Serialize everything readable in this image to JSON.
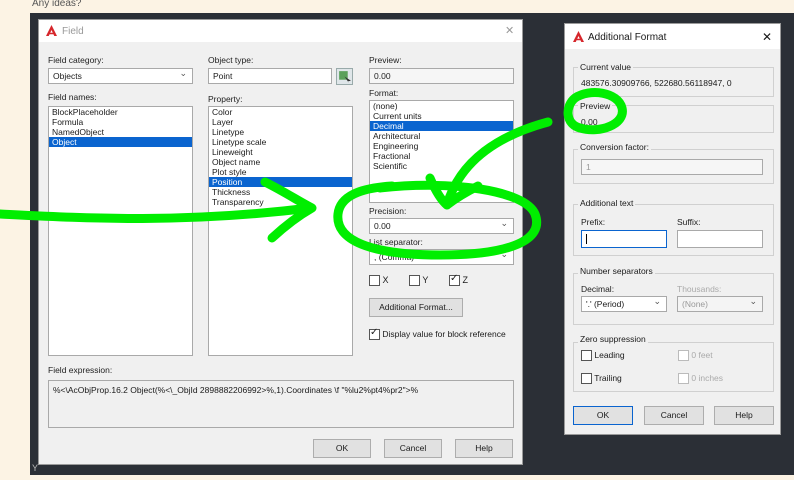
{
  "forum": {
    "question": "Any ideas?"
  },
  "cad": {
    "axis": "Y"
  },
  "field_dialog": {
    "title": "Field",
    "close": "✕",
    "category_label": "Field category:",
    "category_value": "Objects",
    "names_label": "Field names:",
    "names": [
      "BlockPlaceholder",
      "Formula",
      "NamedObject",
      "Object"
    ],
    "names_selected": 3,
    "object_type_label": "Object type:",
    "object_type_value": "Point",
    "property_label": "Property:",
    "properties": [
      "Color",
      "Layer",
      "Linetype",
      "Linetype scale",
      "Lineweight",
      "Object name",
      "Plot style",
      "Position",
      "Thickness",
      "Transparency"
    ],
    "properties_selected": 7,
    "preview_label": "Preview:",
    "preview_value": "0.00",
    "format_label": "Format:",
    "formats": [
      "(none)",
      "Current units",
      "Decimal",
      "Architectural",
      "Engineering",
      "Fractional",
      "Scientific"
    ],
    "formats_selected": 2,
    "precision_label": "Precision:",
    "precision_value": "0.00",
    "list_separator_label": "List separator:",
    "list_separator_value": ", (Comma)",
    "x_label": "X",
    "y_label": "Y",
    "z_label": "Z",
    "z_checked": true,
    "additional_format_btn": "Additional Format...",
    "display_value_label": "Display value for block reference",
    "display_value_checked": true,
    "expression_label": "Field expression:",
    "expression": "%<\\AcObjProp.16.2 Object(%<\\_ObjId 2898882206992>%,1).Coordinates \\f \"%lu2%pt4%pr2\">%",
    "ok": "OK",
    "cancel": "Cancel",
    "help": "Help"
  },
  "additional_format": {
    "title": "Additional Format",
    "close": "✕",
    "current_value_label": "Current value",
    "current_value": "483576.30909766, 522680.56118947, 0",
    "preview_label": "Preview",
    "preview_value": "0.00",
    "conversion_label": "Conversion factor:",
    "conversion_value": "1",
    "additional_text_label": "Additional text",
    "prefix_label": "Prefix:",
    "suffix_label": "Suffix:",
    "number_separators_label": "Number separators",
    "decimal_label": "Decimal:",
    "decimal_value": "'.' (Period)",
    "thousands_label": "Thousands:",
    "thousands_value": "(None)",
    "zero_suppression_label": "Zero suppression",
    "leading_label": "Leading",
    "trailing_label": "Trailing",
    "zero_feet_label": "0 feet",
    "zero_inches_label": "0 inches",
    "ok": "OK",
    "cancel": "Cancel",
    "help": "Help"
  },
  "colors": {
    "annotation": "#00ee00",
    "selection": "#0a64cf",
    "logo": "#d6262b"
  }
}
